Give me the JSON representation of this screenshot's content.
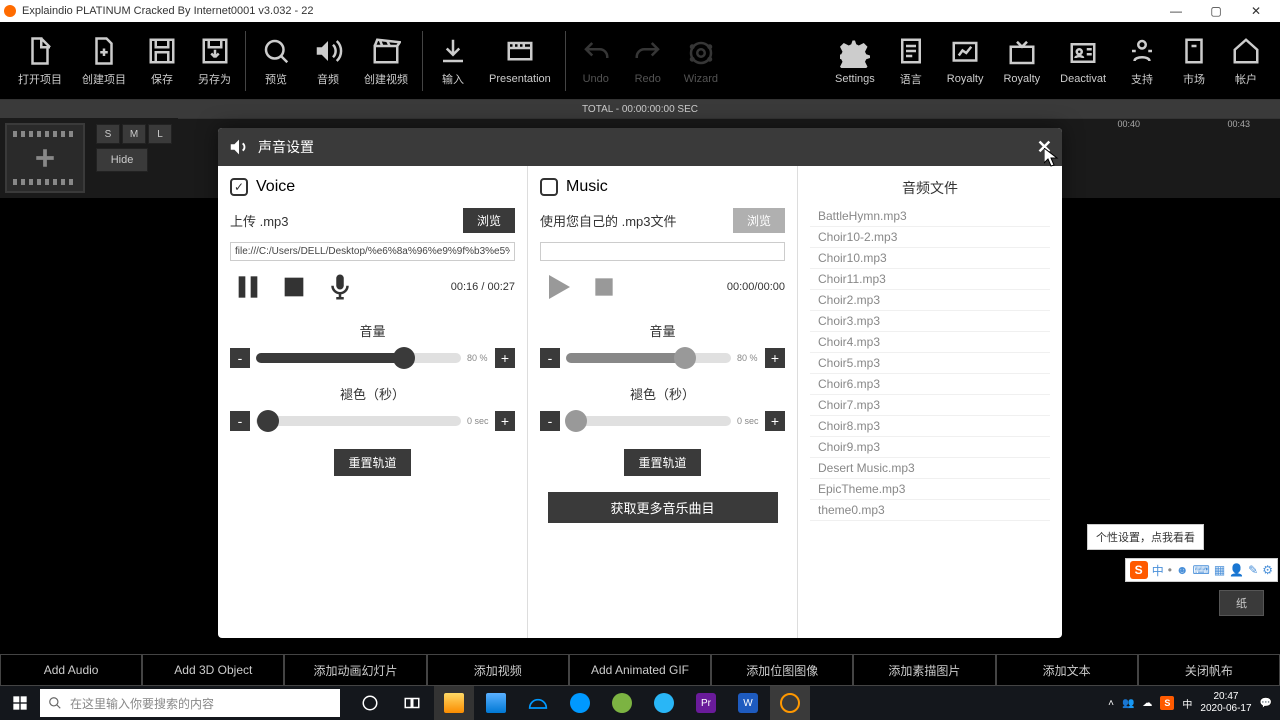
{
  "window": {
    "title": "Explaindio PLATINUM Cracked By Internet0001 v3.032 - 22"
  },
  "toolbar": {
    "open": "打开项目",
    "create": "创建项目",
    "save": "保存",
    "saveas": "另存为",
    "preview": "预览",
    "audio": "音频",
    "createvideo": "创建视频",
    "input": "输入",
    "presentation": "Presentation",
    "undo": "Undo",
    "redo": "Redo",
    "wizard": "Wizard",
    "settings": "Settings",
    "language": "语言",
    "royalty1": "Royalty",
    "royalty2": "Royalty",
    "deactivate": "Deactivat",
    "support": "支持",
    "market": "市场",
    "account": "帐户"
  },
  "timeline": {
    "total": "TOTAL - 00:00:00:00 SEC",
    "hide": "Hide",
    "s": "S",
    "m": "M",
    "l": "L",
    "tick1": "00:40",
    "tick2": "00:43"
  },
  "modal": {
    "title": "声音设置",
    "voice": {
      "check": "Voice",
      "file": "上传 .mp3",
      "browse": "浏览",
      "path": "file:///C:/Users/DELL/Desktop/%e6%8a%96%e9%9f%b3%e5%",
      "timer": "00:16 / 00:27",
      "volume": "音量",
      "vol_val": "80 %",
      "fade": "褪色（秒）",
      "fade_val": "0 sec",
      "reset": "重置轨道"
    },
    "music": {
      "check": "Music",
      "file": "使用您自己的 .mp3文件",
      "browse": "浏览",
      "timer": "00:00/00:00",
      "volume": "音量",
      "vol_val": "80 %",
      "fade": "褪色（秒）",
      "fade_val": "0 sec",
      "reset": "重置轨道",
      "getmore": "获取更多音乐曲目"
    },
    "files": {
      "title": "音频文件",
      "list": [
        "BattleHymn.mp3",
        "Choir10-2.mp3",
        "Choir10.mp3",
        "Choir11.mp3",
        "Choir2.mp3",
        "Choir3.mp3",
        "Choir4.mp3",
        "Choir5.mp3",
        "Choir6.mp3",
        "Choir7.mp3",
        "Choir8.mp3",
        "Choir9.mp3",
        "Desert Music.mp3",
        "EpicTheme.mp3",
        "theme0.mp3"
      ]
    }
  },
  "tooltip": "个性设置，点我看看",
  "paper_btn": "纸",
  "actions": {
    "addaudio": "Add Audio",
    "add3d": "Add 3D Object",
    "addslide": "添加动画幻灯片",
    "addvideo": "添加视频",
    "addgif": "Add Animated GIF",
    "addbitmap": "添加位图图像",
    "addsketch": "添加素描图片",
    "addtext": "添加文本",
    "closecanvas": "关闭帆布"
  },
  "taskbar": {
    "search": "在这里输入你要搜索的内容",
    "time": "20:47",
    "date": "2020-06-17"
  }
}
